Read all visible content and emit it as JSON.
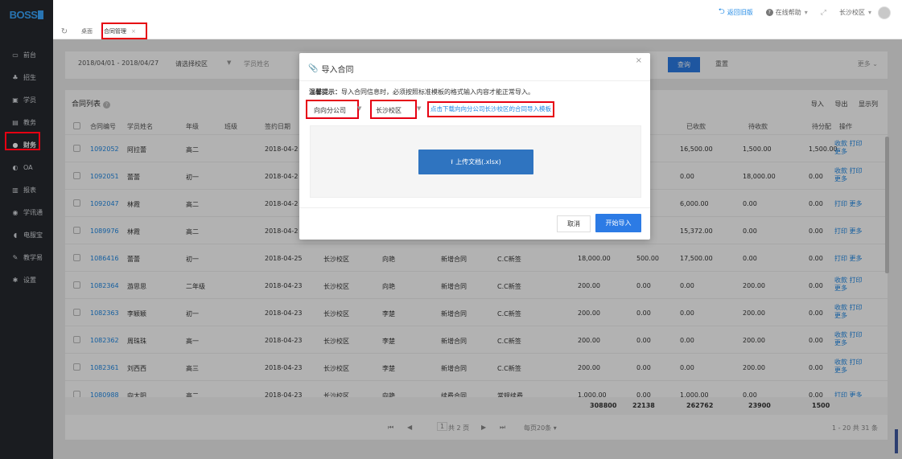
{
  "sidebar": {
    "logo": "BOSS",
    "items": [
      {
        "icon": "monitor-icon",
        "glyph": "▭",
        "label": "前台"
      },
      {
        "icon": "people-icon",
        "glyph": "♣",
        "label": "招生"
      },
      {
        "icon": "id-card-icon",
        "glyph": "▣",
        "label": "学员"
      },
      {
        "icon": "board-icon",
        "glyph": "▤",
        "label": "教务"
      },
      {
        "icon": "finance-icon",
        "glyph": "●",
        "label": "财务"
      },
      {
        "icon": "toggle-icon",
        "glyph": "◐",
        "label": "OA"
      },
      {
        "icon": "chart-icon",
        "glyph": "▥",
        "label": "报表"
      },
      {
        "icon": "message-icon",
        "glyph": "◉",
        "label": "学讯通"
      },
      {
        "icon": "phone-icon",
        "glyph": "◖",
        "label": "电服宝"
      },
      {
        "icon": "teach-icon",
        "glyph": "✎",
        "label": "教学易"
      },
      {
        "icon": "gear-icon",
        "glyph": "✱",
        "label": "设置"
      }
    ]
  },
  "header": {
    "back_old": "返回旧版",
    "help": "在线帮助",
    "campus": "长沙校区"
  },
  "tabs": [
    {
      "label": "桌面"
    },
    {
      "label": "合同管理"
    }
  ],
  "filters": {
    "date_range": "2018/04/01 - 2018/04/27",
    "campus_placeholder": "请选择校区",
    "student_placeholder": "学员姓名",
    "query": "查询",
    "reset": "重置",
    "more": "更多"
  },
  "list": {
    "title": "合同列表",
    "import": "导入",
    "export": "导出",
    "columns_btn": "显示列",
    "headers": [
      "合同编号",
      "学员姓名",
      "年级",
      "班级",
      "签约日期",
      "",
      "",
      "",
      "",
      "",
      "",
      "已收款",
      "待收款",
      "待分配",
      "操作"
    ],
    "rows": [
      {
        "id": "1092052",
        "name": "阿拉蕾",
        "grade": "高二",
        "date": "2018-04-2",
        "campus": "",
        "staff": "",
        "type": "",
        "src": "",
        "amount": "",
        "disc": "",
        "received": "16,500.00",
        "pending": "1,500.00",
        "unalloc": "1,500.00",
        "ops1": "收款 打印",
        "ops2": "更多"
      },
      {
        "id": "1092051",
        "name": "蕾蕾",
        "grade": "初一",
        "date": "2018-04-2",
        "campus": "",
        "staff": "",
        "type": "",
        "src": "",
        "amount": "",
        "disc": "",
        "received": "0.00",
        "pending": "18,000.00",
        "unalloc": "0.00",
        "ops1": "收款 打印",
        "ops2": "更多"
      },
      {
        "id": "1092047",
        "name": "林霞",
        "grade": "高二",
        "date": "2018-04-2",
        "campus": "",
        "staff": "",
        "type": "",
        "src": "",
        "amount": "",
        "disc": "",
        "received": "6,000.00",
        "pending": "0.00",
        "unalloc": "0.00",
        "ops1": "打印 更多",
        "ops2": ""
      },
      {
        "id": "1089976",
        "name": "林霞",
        "grade": "高二",
        "date": "2018-04-2",
        "campus": "",
        "staff": "",
        "type": "",
        "src": "",
        "amount": "",
        "disc": "",
        "received": "15,372.00",
        "pending": "0.00",
        "unalloc": "0.00",
        "ops1": "打印 更多",
        "ops2": ""
      },
      {
        "id": "1086416",
        "name": "蕾蕾",
        "grade": "初一",
        "date": "2018-04-25",
        "campus": "长沙校区",
        "staff": "向艳",
        "type": "新增合同",
        "src": "C.C新签",
        "amount": "18,000.00",
        "disc": "500.00",
        "received": "17,500.00",
        "pending": "0.00",
        "unalloc": "0.00",
        "ops1": "打印 更多",
        "ops2": ""
      },
      {
        "id": "1082364",
        "name": "游思思",
        "grade": "二年级",
        "date": "2018-04-23",
        "campus": "长沙校区",
        "staff": "向艳",
        "type": "新增合同",
        "src": "C.C新签",
        "amount": "200.00",
        "disc": "0.00",
        "received": "0.00",
        "pending": "200.00",
        "unalloc": "0.00",
        "ops1": "收款 打印",
        "ops2": "更多"
      },
      {
        "id": "1082363",
        "name": "李颖颖",
        "grade": "初一",
        "date": "2018-04-23",
        "campus": "长沙校区",
        "staff": "李楚",
        "type": "新增合同",
        "src": "C.C新签",
        "amount": "200.00",
        "disc": "0.00",
        "received": "0.00",
        "pending": "200.00",
        "unalloc": "0.00",
        "ops1": "收款 打印",
        "ops2": "更多"
      },
      {
        "id": "1082362",
        "name": "周珠珠",
        "grade": "高一",
        "date": "2018-04-23",
        "campus": "长沙校区",
        "staff": "李楚",
        "type": "新增合同",
        "src": "C.C新签",
        "amount": "200.00",
        "disc": "0.00",
        "received": "0.00",
        "pending": "200.00",
        "unalloc": "0.00",
        "ops1": "收款 打印",
        "ops2": "更多"
      },
      {
        "id": "1082361",
        "name": "刘西西",
        "grade": "高三",
        "date": "2018-04-23",
        "campus": "长沙校区",
        "staff": "李楚",
        "type": "新增合同",
        "src": "C.C新签",
        "amount": "200.00",
        "disc": "0.00",
        "received": "0.00",
        "pending": "200.00",
        "unalloc": "0.00",
        "ops1": "收款 打印",
        "ops2": "更多"
      },
      {
        "id": "1080988",
        "name": "向太阳",
        "grade": "高二",
        "date": "2018-04-23",
        "campus": "长沙校区",
        "staff": "向艳",
        "type": "续费合同",
        "src": "常规续费",
        "amount": "1,000.00",
        "disc": "0.00",
        "received": "1,000.00",
        "pending": "0.00",
        "unalloc": "0.00",
        "ops1": "打印 更多",
        "ops2": ""
      }
    ],
    "totals": {
      "amount": "308800",
      "disc": "22138",
      "received": "262762",
      "pending": "23900",
      "unalloc": "1500"
    },
    "pager": {
      "first": "⏮",
      "prev": "◀",
      "page": "1",
      "of": "共 2 页",
      "next": "▶",
      "last": "⏭",
      "per_page": "每页20条",
      "summary": "1 - 20  共 31 条"
    }
  },
  "modal": {
    "title": "导入合同",
    "tip_label": "温馨提示：",
    "tip_text": "导入合同信息时，必须按照标准模板的格式输入内容才能正常导入。",
    "company": "向向分公司",
    "campus": "长沙校区",
    "download_link": "点击下载向向分公司长沙校区的合同导入模板",
    "upload": "上传文档(.xlsx)",
    "cancel": "取消",
    "start": "开始导入",
    "close": "×"
  },
  "colors": {
    "accent": "#2c7be5",
    "sidebar": "#26292e",
    "highlight": "#e60012"
  }
}
